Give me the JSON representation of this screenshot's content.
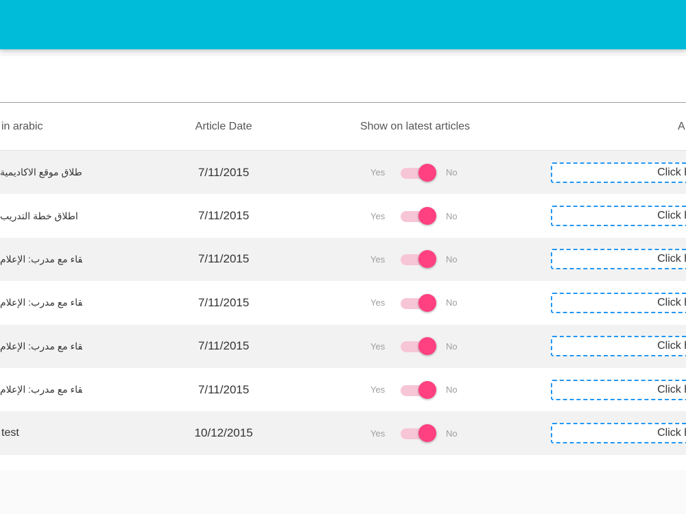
{
  "table": {
    "headers": {
      "title": "in arabic",
      "date": "Article Date",
      "show": "Show on latest articles",
      "action": "A"
    },
    "rows": [
      {
        "title": "تم اطلاق موقع الاكاديمية",
        "date": "7/11/2015",
        "yes": "Yes",
        "no": "No",
        "toggle_on": true,
        "action": "Click he"
      },
      {
        "title": "اطلاق خطة التدريب",
        "date": "7/11/2015",
        "yes": "Yes",
        "no": "No",
        "toggle_on": true,
        "action": "Click he"
      },
      {
        "title": "لقاء مع مدرب: الإعلام",
        "date": "7/11/2015",
        "yes": "Yes",
        "no": "No",
        "toggle_on": true,
        "action": "Click he"
      },
      {
        "title": "لقاء مع مدرب: الإعلام",
        "date": "7/11/2015",
        "yes": "Yes",
        "no": "No",
        "toggle_on": true,
        "action": "Click he"
      },
      {
        "title": "لقاء مع مدرب: الإعلام",
        "date": "7/11/2015",
        "yes": "Yes",
        "no": "No",
        "toggle_on": true,
        "action": "Click he"
      },
      {
        "title": "لقاء مع مدرب: الإعلام",
        "date": "7/11/2015",
        "yes": "Yes",
        "no": "No",
        "toggle_on": true,
        "action": "Click he"
      },
      {
        "title": "test",
        "date": "10/12/2015",
        "yes": "Yes",
        "no": "No",
        "toggle_on": true,
        "action": "Click he"
      }
    ]
  },
  "colors": {
    "topbar": "#00bcd8",
    "toggle_accent": "#ff4081",
    "button_border": "#2196f3"
  }
}
